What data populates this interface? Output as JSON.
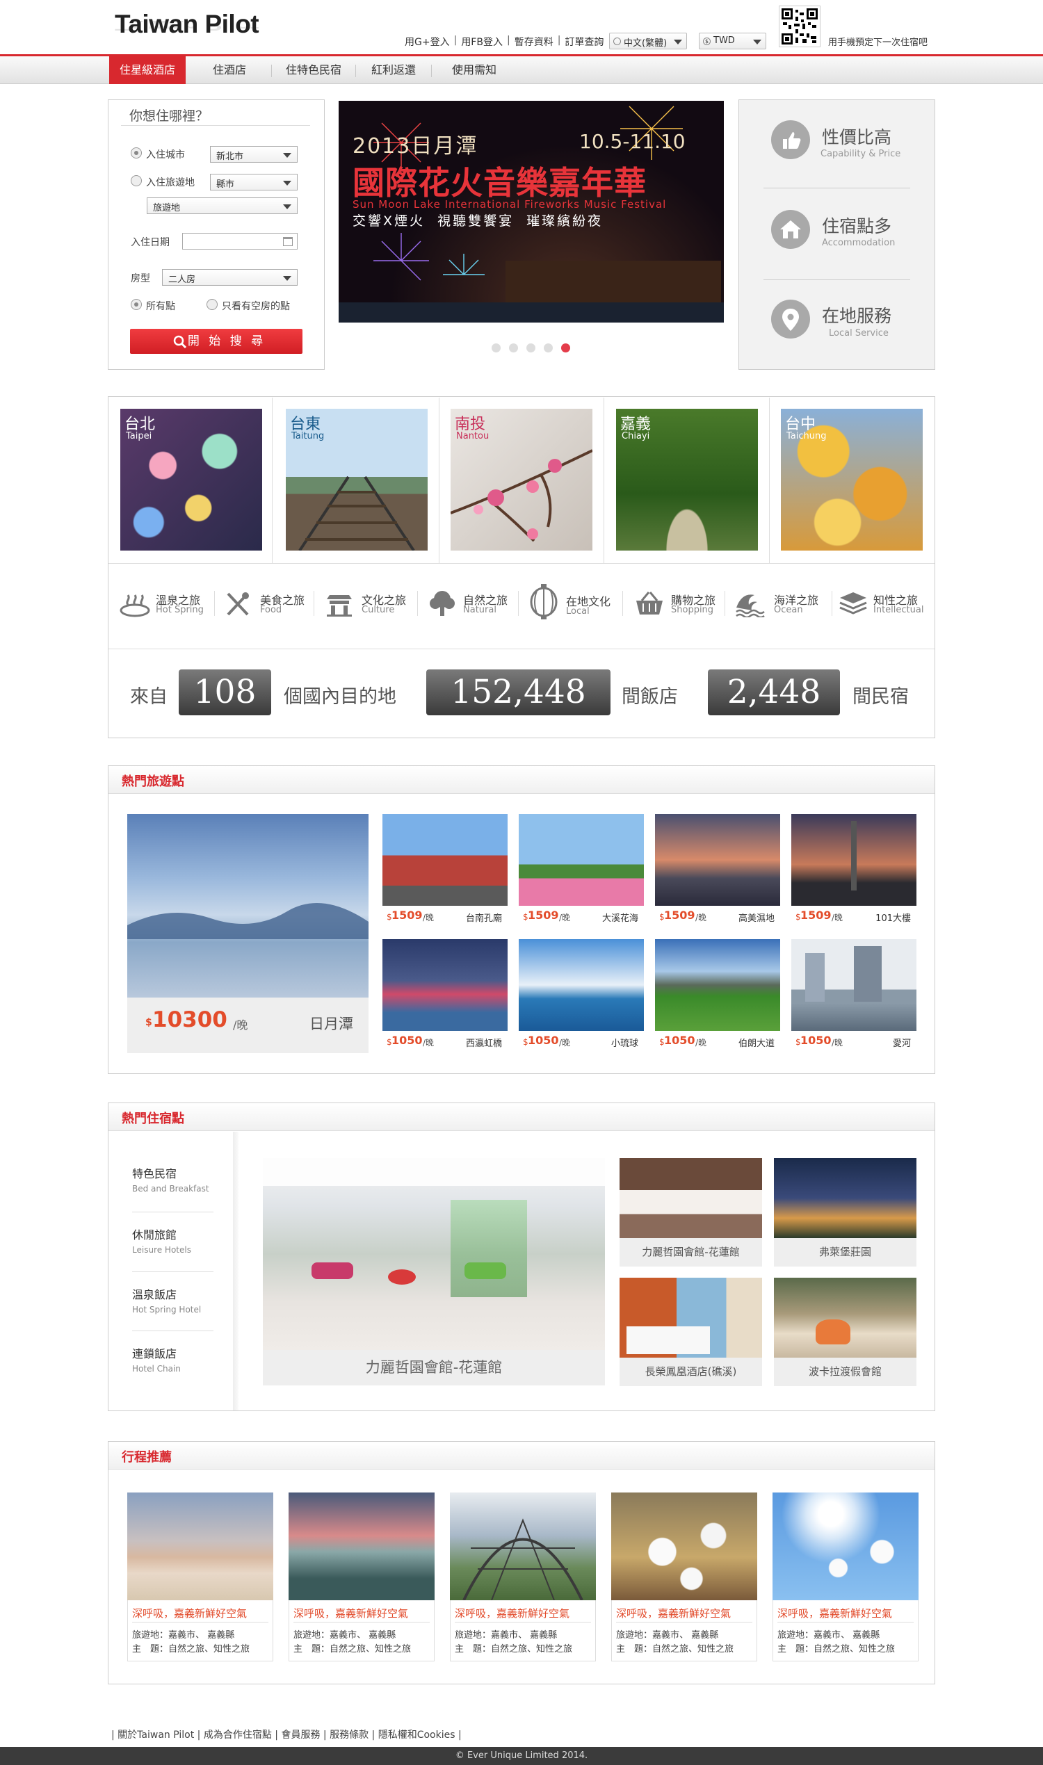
{
  "header": {
    "logo": "Taiwan Pilot",
    "links": [
      "用G+登入",
      "用FB登入",
      "暫存資料",
      "訂單查詢"
    ],
    "language": "中文(繁體)",
    "currency": "TWD",
    "qr_text": "用手機預定下一次住宿吧"
  },
  "nav": {
    "items": [
      "住星級酒店",
      "住酒店",
      "住特色民宿",
      "紅利返還",
      "使用需知"
    ]
  },
  "search": {
    "title": "你想住哪裡？",
    "city_label": "入住城市",
    "city_value": "新北市",
    "area_label": "入住旅遊地",
    "area_value": "縣市",
    "spot_value": "旅遊地",
    "date_label": "入住日期",
    "room_label": "房型",
    "room_value": "二人房",
    "opt_all": "所有點",
    "opt_vacant": "只看有空房的點",
    "button": "開 始 搜 尋"
  },
  "banner": {
    "line1": "2013日月潭",
    "dates": "10.5-11.10",
    "line2": "國際花火音樂嘉年華",
    "line3": "Sun Moon Lake International Fireworks Music Festival",
    "line4": "交響X煙火  視聽雙饗宴  璀璨繽紛夜",
    "slides": 5,
    "active_slide": 5
  },
  "features": [
    {
      "zh": "性價比高",
      "en": "Capability & Price"
    },
    {
      "zh": "住宿點多",
      "en": "Accommodation"
    },
    {
      "zh": "在地服務",
      "en": "Local Service"
    }
  ],
  "cities": [
    {
      "zh": "台北",
      "en": "Taipei"
    },
    {
      "zh": "台東",
      "en": "Taitung"
    },
    {
      "zh": "南投",
      "en": "Nantou"
    },
    {
      "zh": "嘉義",
      "en": "Chiayi"
    },
    {
      "zh": "台中",
      "en": "Taichung"
    }
  ],
  "themes": [
    {
      "zh": "溫泉之旅",
      "en": "Hot Spring"
    },
    {
      "zh": "美食之旅",
      "en": "Food"
    },
    {
      "zh": "文化之旅",
      "en": "Culture"
    },
    {
      "zh": "自然之旅",
      "en": "Natural"
    },
    {
      "zh": "在地文化",
      "en": "Local"
    },
    {
      "zh": "購物之旅",
      "en": "Shopping"
    },
    {
      "zh": "海洋之旅",
      "en": "Ocean"
    },
    {
      "zh": "知性之旅",
      "en": "Intellectual"
    }
  ],
  "stats": {
    "prefix": "來自",
    "destinations": "108",
    "destinations_label": "個國內目的地",
    "hotels": "152,448",
    "hotels_label": "間飯店",
    "bnb": "2,448",
    "bnb_label": "間民宿"
  },
  "hot_spots": {
    "title": "熱門旅遊點",
    "main": {
      "price": "10300",
      "unit": "/晚",
      "name": "日月潭",
      "currency": "$"
    },
    "items": [
      {
        "price": "1509",
        "name": "台南孔廟"
      },
      {
        "price": "1509",
        "name": "大溪花海"
      },
      {
        "price": "1509",
        "name": "高美濕地"
      },
      {
        "price": "1509",
        "name": "101大樓"
      },
      {
        "price": "1050",
        "name": "西瀛虹橋"
      },
      {
        "price": "1050",
        "name": "小琉球"
      },
      {
        "price": "1050",
        "name": "伯朗大道"
      },
      {
        "price": "1050",
        "name": "愛河"
      }
    ],
    "unit": "/晚",
    "currency": "$"
  },
  "hot_stays": {
    "title": "熱門住宿點",
    "side": [
      {
        "zh": "特色民宿",
        "en": "Bed and Breakfast"
      },
      {
        "zh": "休閒旅館",
        "en": "Leisure Hotels"
      },
      {
        "zh": "溫泉飯店",
        "en": "Hot Spring Hotel"
      },
      {
        "zh": "連鎖飯店",
        "en": "Hotel Chain"
      }
    ],
    "main": "力麗哲園會館-花蓮館",
    "items": [
      "力麗哲園會館-花蓮館",
      "弗萊堡莊園",
      "長榮鳳凰酒店(礁溪)",
      "波卡拉渡假會館"
    ]
  },
  "trips": {
    "title": "行程推薦",
    "items": [
      {
        "title": "深呼吸，嘉義新鮮好空氣",
        "dest": "旅遊地：嘉義市、 嘉義縣",
        "theme": "主　題：自然之旅、知性之旅"
      },
      {
        "title": "深呼吸，嘉義新鮮好空氣",
        "dest": "旅遊地：嘉義市、 嘉義縣",
        "theme": "主　題：自然之旅、知性之旅"
      },
      {
        "title": "深呼吸，嘉義新鮮好空氣",
        "dest": "旅遊地：嘉義市、 嘉義縣",
        "theme": "主　題：自然之旅、知性之旅"
      },
      {
        "title": "深呼吸，嘉義新鮮好空氣",
        "dest": "旅遊地：嘉義市、 嘉義縣",
        "theme": "主　題：自然之旅、知性之旅"
      },
      {
        "title": "深呼吸，嘉義新鮮好空氣",
        "dest": "旅遊地：嘉義市、 嘉義縣",
        "theme": "主　題：自然之旅、知性之旅"
      }
    ]
  },
  "footer": {
    "links": [
      "關於Taiwan Pilot",
      "成為合作住宿點",
      "會員服務",
      "服務條款",
      "隱私權和Cookies"
    ],
    "copyright": "© Ever Unique Limited 2014."
  }
}
